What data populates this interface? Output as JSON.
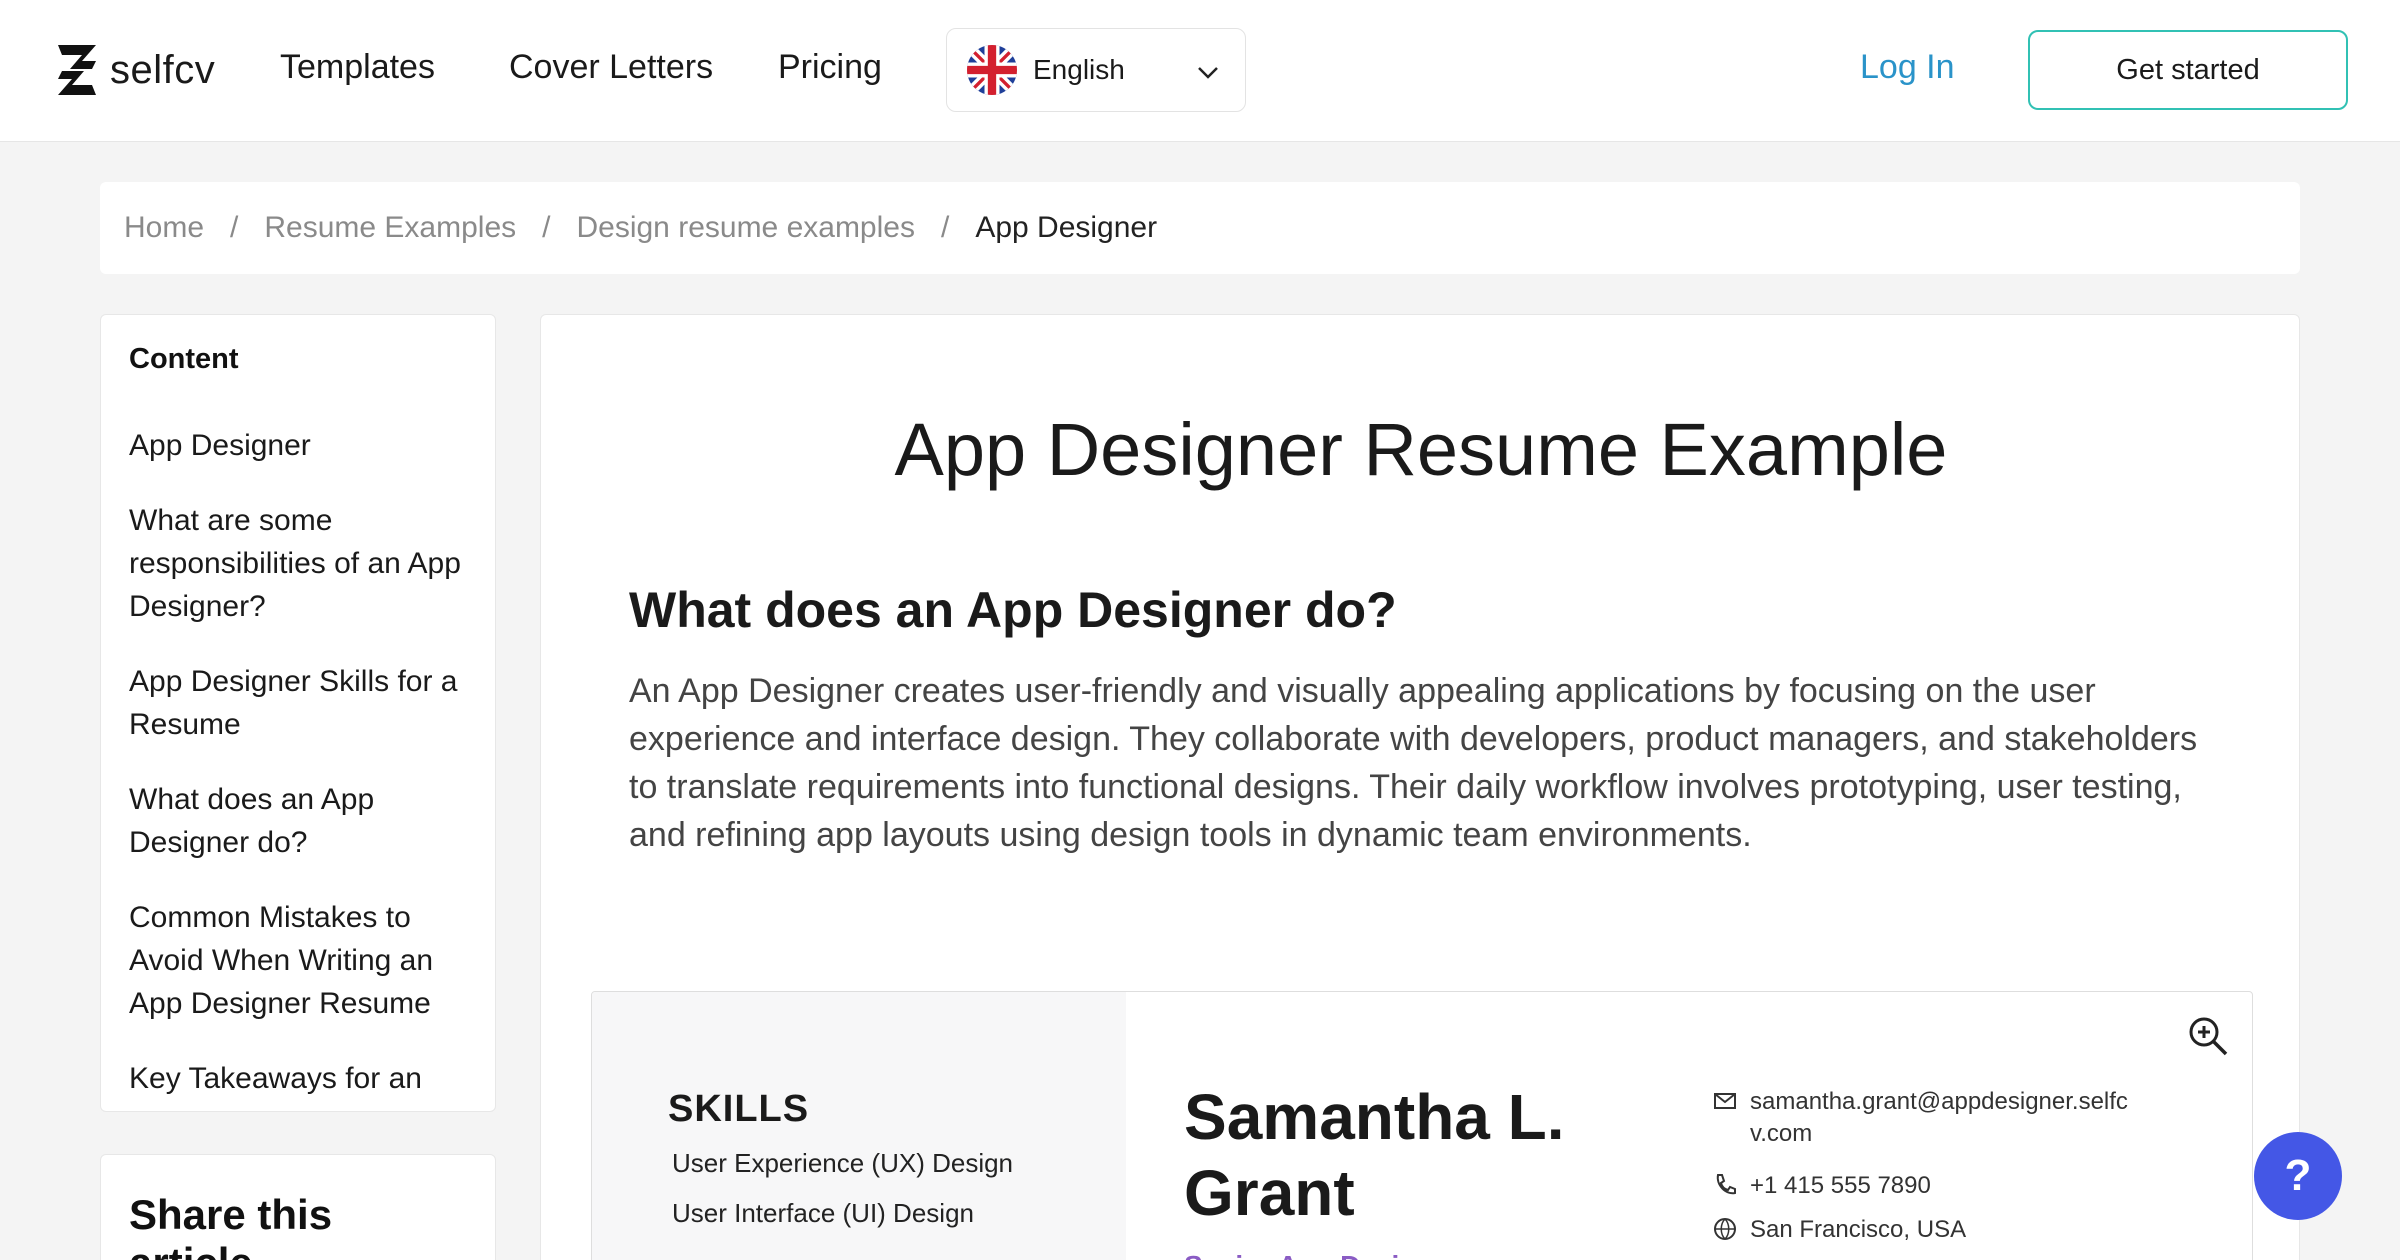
{
  "header": {
    "logo_text": "selfcv",
    "nav": [
      "Templates",
      "Cover Letters",
      "Pricing"
    ],
    "language": "English",
    "login": "Log In",
    "cta": "Get started"
  },
  "breadcrumb": {
    "items": [
      "Home",
      "Resume Examples",
      "Design resume examples"
    ],
    "separator": "/",
    "current": "App Designer"
  },
  "sidebar": {
    "title": "Content",
    "items": [
      {
        "label": "App Designer"
      },
      {
        "label": "What are some responsibilities of an App Designer?"
      },
      {
        "label": "App Designer Skills for a Resume"
      },
      {
        "label": "What does an App Designer do?"
      },
      {
        "label": "Common Mistakes to Avoid When Writing an App Designer Resume"
      },
      {
        "label": "Key Takeaways for an"
      }
    ],
    "share_title": "Share this article"
  },
  "main": {
    "title": "App Designer Resume Example",
    "subtitle": "What does an App Designer do?",
    "body": "An App Designer creates user-friendly and visually appealing applications by focusing on the user experience and interface design. They collaborate with developers, product managers, and stakeholders to translate requirements into functional designs. Their daily workflow involves prototyping, user testing, and refining app layouts using design tools in dynamic team environments."
  },
  "resume": {
    "skills_title": "SKILLS",
    "skills": [
      "User Experience (UX) Design",
      "User Interface (UI) Design"
    ],
    "name_line1": "Samantha L.",
    "name_line2": "Grant",
    "role": "Senior App Designer",
    "email_line1": "samantha.grant@appdesigner.selfc",
    "email_line2": "v.com",
    "phone": "+1 415 555 7890",
    "location": "San Francisco, USA"
  },
  "help_label": "?",
  "colors": {
    "accent_blue": "#2a93c9",
    "cta_border": "#31c1b4",
    "help_bg": "#4457e6",
    "role_purple": "#8a5cc4"
  }
}
